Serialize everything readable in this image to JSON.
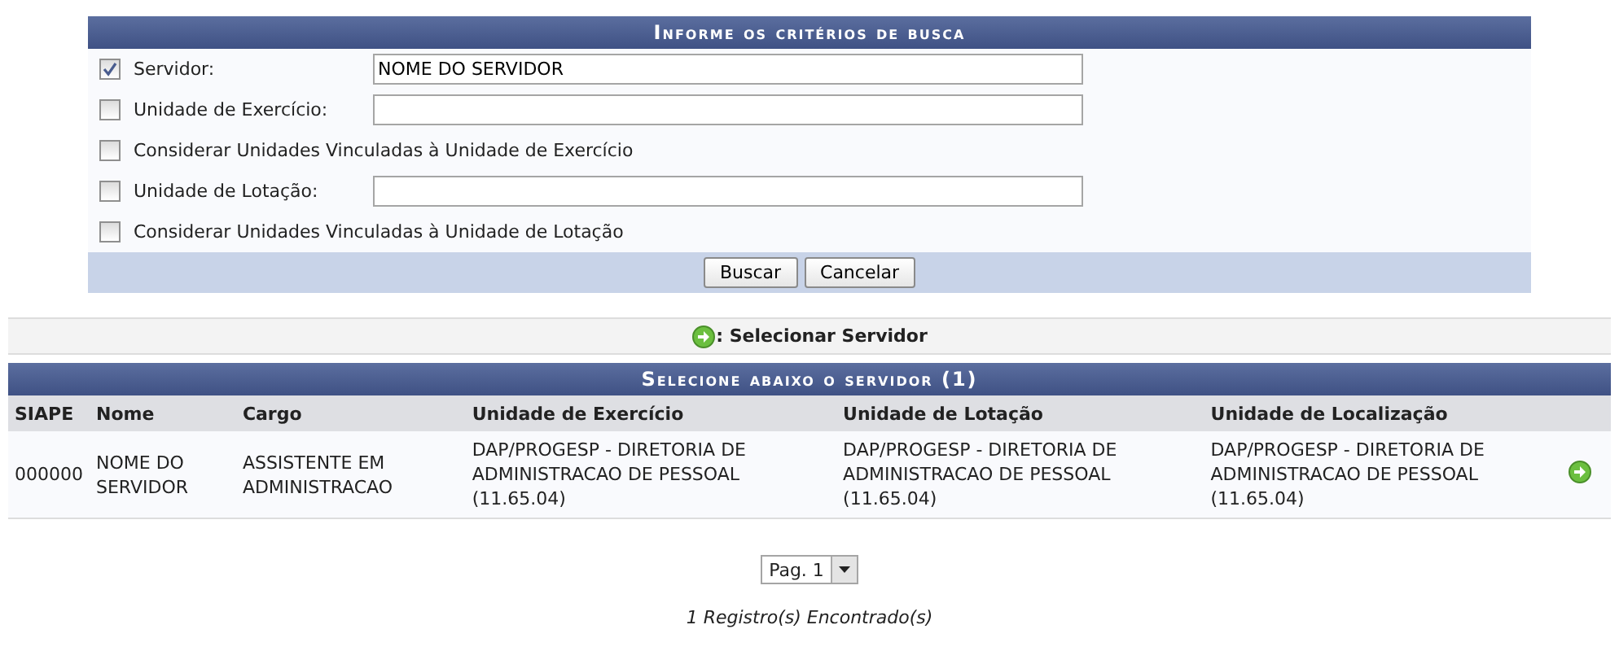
{
  "search_form": {
    "title": "Informe os critérios de busca",
    "criteria": [
      {
        "kind": "field",
        "label": "Servidor:",
        "checked": true,
        "value": "NOME DO SERVIDOR"
      },
      {
        "kind": "field",
        "label": "Unidade de Exercício:",
        "checked": false
      },
      {
        "kind": "option",
        "label": "Considerar Unidades Vinculadas à Unidade de Exercício",
        "checked": false
      },
      {
        "kind": "field",
        "label": "Unidade de Lotação:",
        "checked": false
      },
      {
        "kind": "option",
        "label": "Considerar Unidades Vinculadas à Unidade de Lotação",
        "checked": false
      }
    ],
    "buttons": [
      "Buscar",
      "Cancelar"
    ]
  },
  "legend": {
    "text": ": Selecionar Servidor"
  },
  "results": {
    "title": "Selecione abaixo o servidor (1)",
    "columns": [
      "SIAPE",
      "Nome",
      "Cargo",
      "Unidade de Exercício",
      "Unidade de Lotação",
      "Unidade de Localização"
    ],
    "rows": [
      {
        "cells": [
          "000000",
          "NOME DO SERVIDOR",
          "ASSISTENTE EM ADMINISTRACAO",
          "DAP/PROGESP - DIRETORIA DE ADMINISTRACAO DE PESSOAL (11.65.04)",
          "DAP/PROGESP - DIRETORIA DE ADMINISTRACAO DE PESSOAL (11.65.04)",
          "DAP/PROGESP - DIRETORIA DE ADMINISTRACAO DE PESSOAL (11.65.04)"
        ]
      }
    ]
  },
  "pager": {
    "value": "Pag. 1"
  },
  "footer": "1 Registro(s) Encontrado(s)"
}
